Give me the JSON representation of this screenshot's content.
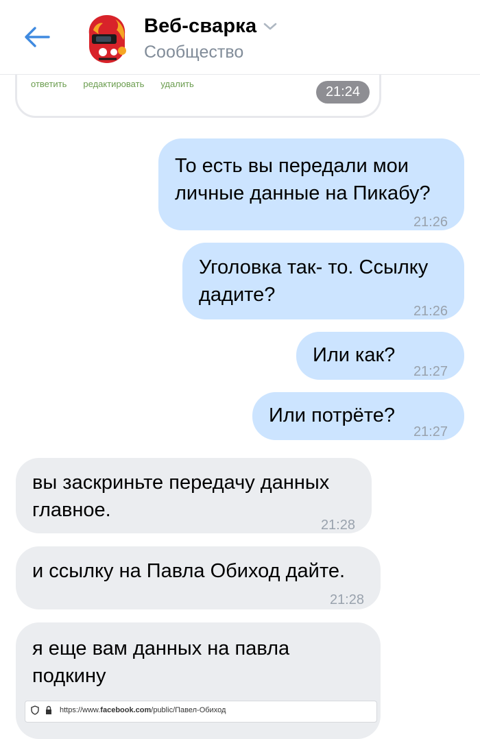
{
  "header": {
    "title": "Веб-сварка",
    "subtitle": "Сообщество",
    "back_icon": "arrow-left-icon",
    "dropdown_icon": "chevron-down-icon"
  },
  "previous_message": {
    "actions": [
      "ответить",
      "редактировать",
      "удалить"
    ],
    "time": "21:24"
  },
  "messages": [
    {
      "direction": "out",
      "lines": [
        "То есть вы передали мои",
        "личные данные на Пикабу?"
      ],
      "time": "21:26"
    },
    {
      "direction": "out",
      "lines": [
        "Уголовка так- то. Ссылку",
        "дадите?"
      ],
      "time": "21:26"
    },
    {
      "direction": "out",
      "lines": [
        "Или как?"
      ],
      "time": "21:27"
    },
    {
      "direction": "out",
      "lines": [
        "Или потрёте?"
      ],
      "time": "21:27"
    },
    {
      "direction": "in",
      "lines": [
        "вы заскриньте передачу данных",
        "главное."
      ],
      "time": "21:28"
    },
    {
      "direction": "in",
      "lines": [
        "и ссылку на Павла Обиход дайте."
      ],
      "time": "21:28"
    },
    {
      "direction": "in",
      "lines": [
        "я еще вам данных на павла",
        "подкину"
      ],
      "time": ""
    }
  ],
  "attachment": {
    "url_prefix": "https://www.",
    "url_domain": "facebook.com",
    "url_path": "/public/Павел-Обиход"
  },
  "colors": {
    "accent": "#3f8ae0",
    "outgoing_bubble": "#cce4ff",
    "incoming_bubble": "#ebedf0",
    "secondary_text": "#818c99"
  }
}
